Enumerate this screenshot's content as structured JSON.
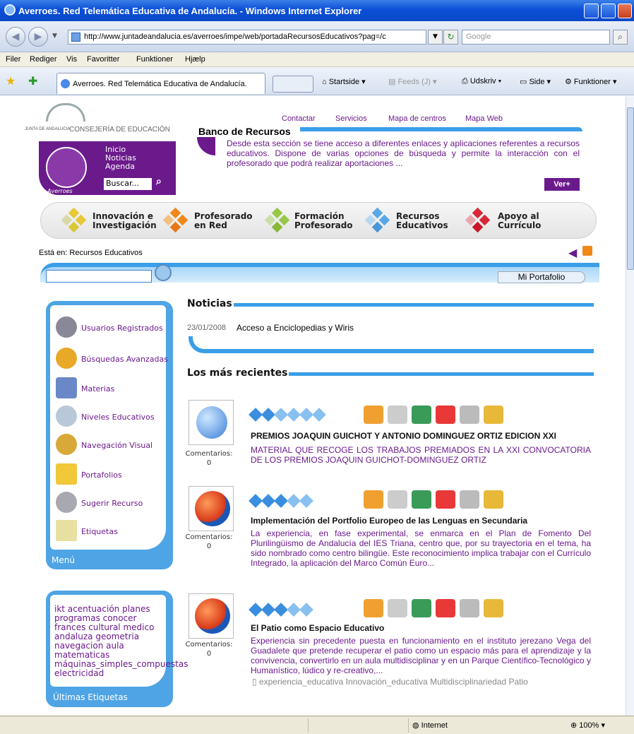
{
  "window": {
    "title": "Averroes. Red Telemática Educativa de Andalucía. - Windows Internet Explorer"
  },
  "browser": {
    "url": "http://www.juntadeandalucia.es/averroes/impe/web/portadaRecursosEducativos?pag=/c",
    "search_placeholder": "Google",
    "menu": [
      "Filer",
      "Rediger",
      "Vis",
      "Favoritter",
      "Funktioner",
      "Hjælp"
    ],
    "tab_title": "Averroes. Red Telemática Educativa de Andalucía.",
    "commands": [
      "Startside",
      "Feeds (J)",
      "Udskriv",
      "Side",
      "Funktioner"
    ],
    "status_zone": "Internet",
    "zoom": "100%"
  },
  "header": {
    "logo_caption": "JUNTA DE ANDALUCIA",
    "consejeria": "CONSEJERÍA DE EDUCACIÓN",
    "top_links": [
      "Contactar",
      "Servicios",
      "Mapa de centros",
      "Mapa Web"
    ],
    "box_links": [
      "Inicio",
      "Noticias",
      "Agenda"
    ],
    "box_search": "Buscar...",
    "box_brand": "Averroes",
    "banner_title": "Banco de Recursos",
    "banner_text": "Desde esta sección se tiene acceso a diferentes enlaces y aplicaciones referentes a recursos educativos. Dispone de varias opciones de búsqueda y permite la interacción con el profesorado que podrá realizar aportaciones ...",
    "ver_button": "Ver+"
  },
  "nav_tabs": [
    {
      "line1": "Innovación e",
      "line2": "Investigación"
    },
    {
      "line1": "Profesorado",
      "line2": "en Red"
    },
    {
      "line1": "Formación",
      "line2": "Profesorado"
    },
    {
      "line1": "Recursos",
      "line2": "Educativos"
    },
    {
      "line1": "Apoyo al",
      "line2": "Currículo"
    }
  ],
  "breadcrumb": {
    "prefix": "Está en:",
    "current": "Recursos Educativos"
  },
  "portfolio_button": "Mi Portafolio",
  "side_menu": {
    "items": [
      "Usuarios Registrados",
      "Búsquedas Avanzadas",
      "Materias",
      "Niveles Educativos",
      "Navegación Visual",
      "Portafolios",
      "Sugerir Recurso",
      "Etiquetas"
    ],
    "footer": "Menú"
  },
  "tags": {
    "text": "ikt acentuación planes programas conocer frances cultural medico andaluza geometria navegacion aula matematicas máquinas_simples_compuestas electricidad",
    "footer": "Últimas Etiquetas"
  },
  "news": {
    "heading": "Noticias",
    "date": "23/01/2008",
    "title": "Acceso a Enciclopedias y Wiris"
  },
  "recent": {
    "heading": "Los más recientes",
    "comments_label": "Comentarios:",
    "items": [
      {
        "title": "PREMIOS JOAQUIN GUICHOT Y ANTONIO DOMINGUEZ ORTIZ EDICION XXI",
        "desc": "MATERIAL QUE RECOGE LOS TRABAJOS PREMIADOS EN LA XXI CONVOCATORIA DE LOS PREMIOS JOAQUIN GUICHOT-DOMINGUEZ ORTIZ",
        "comments": "0",
        "tags": ""
      },
      {
        "title": "Implementación del Portfolio Europeo de las Lenguas en Secundaria",
        "desc": "La experiencia, en fase experimental, se enmarca en el Plan de Fomento Del Plurilingüismo de Andalucía del IES Triana, centro que, por su trayectoria en el tema, ha sido nombrado como centro bilingüe. Este reconocimiento implica trabajar con el Currículo Integrado, la aplicación del Marco Común Euro...",
        "comments": "0",
        "tags": ""
      },
      {
        "title": "El Patio como Espacio Educativo",
        "desc": "Experiencia sin precedente puesta en funcionamiento en el instituto jerezano Vega del Guadalete que pretende recuperar el patio como un espacio más para el aprendizaje y la convivencia, convertirlo en un aula multidisciplinar y en un Parque Científico-Tecnológico y Humanístico, lúdico y re-creativo,...",
        "comments": "0",
        "tags": "experiencia_educativa Innovación_educativa Multidisciplinariedad Patio"
      }
    ]
  },
  "colors": {
    "purple": "#6b1a8c",
    "blue": "#3a9ee8",
    "xp_blue": "#0b4fd8"
  }
}
